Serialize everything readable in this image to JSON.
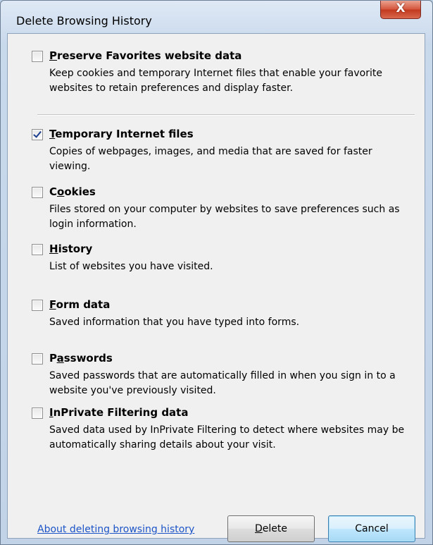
{
  "window": {
    "title": "Delete Browsing History",
    "close_glyph": "X"
  },
  "options": [
    {
      "label": "Preserve Favorites website data",
      "accesskey": "P",
      "checked": false,
      "description": "Keep cookies and temporary Internet files that enable your favorite websites to retain preferences and display faster."
    },
    {
      "label": "Temporary Internet files",
      "accesskey": "T",
      "checked": true,
      "description": "Copies of webpages, images, and media that are saved for faster viewing."
    },
    {
      "label": "Cookies",
      "accesskey": "o",
      "checked": false,
      "description": "Files stored on your computer by websites to save preferences such as login information."
    },
    {
      "label": "History",
      "accesskey": "H",
      "checked": false,
      "description": "List of websites you have visited."
    },
    {
      "label": "Form data",
      "accesskey": "F",
      "checked": false,
      "description": "Saved information that you have typed into forms."
    },
    {
      "label": "Passwords",
      "accesskey": "a",
      "checked": false,
      "description": "Saved passwords that are automatically filled in when you sign in to a website you've previously visited."
    },
    {
      "label": "InPrivate Filtering data",
      "accesskey": "I",
      "checked": false,
      "description": "Saved data used by InPrivate Filtering to detect where websites may be automatically sharing details about your visit."
    }
  ],
  "footer": {
    "link_text": "About deleting browsing history",
    "delete_label": "Delete",
    "cancel_label": "Cancel"
  },
  "colors": {
    "link": "#1c54c7",
    "check": "#1c3f8f",
    "close_button": "#c2391f"
  },
  "icons": {
    "close": "close-icon",
    "check": "checkmark-icon"
  }
}
